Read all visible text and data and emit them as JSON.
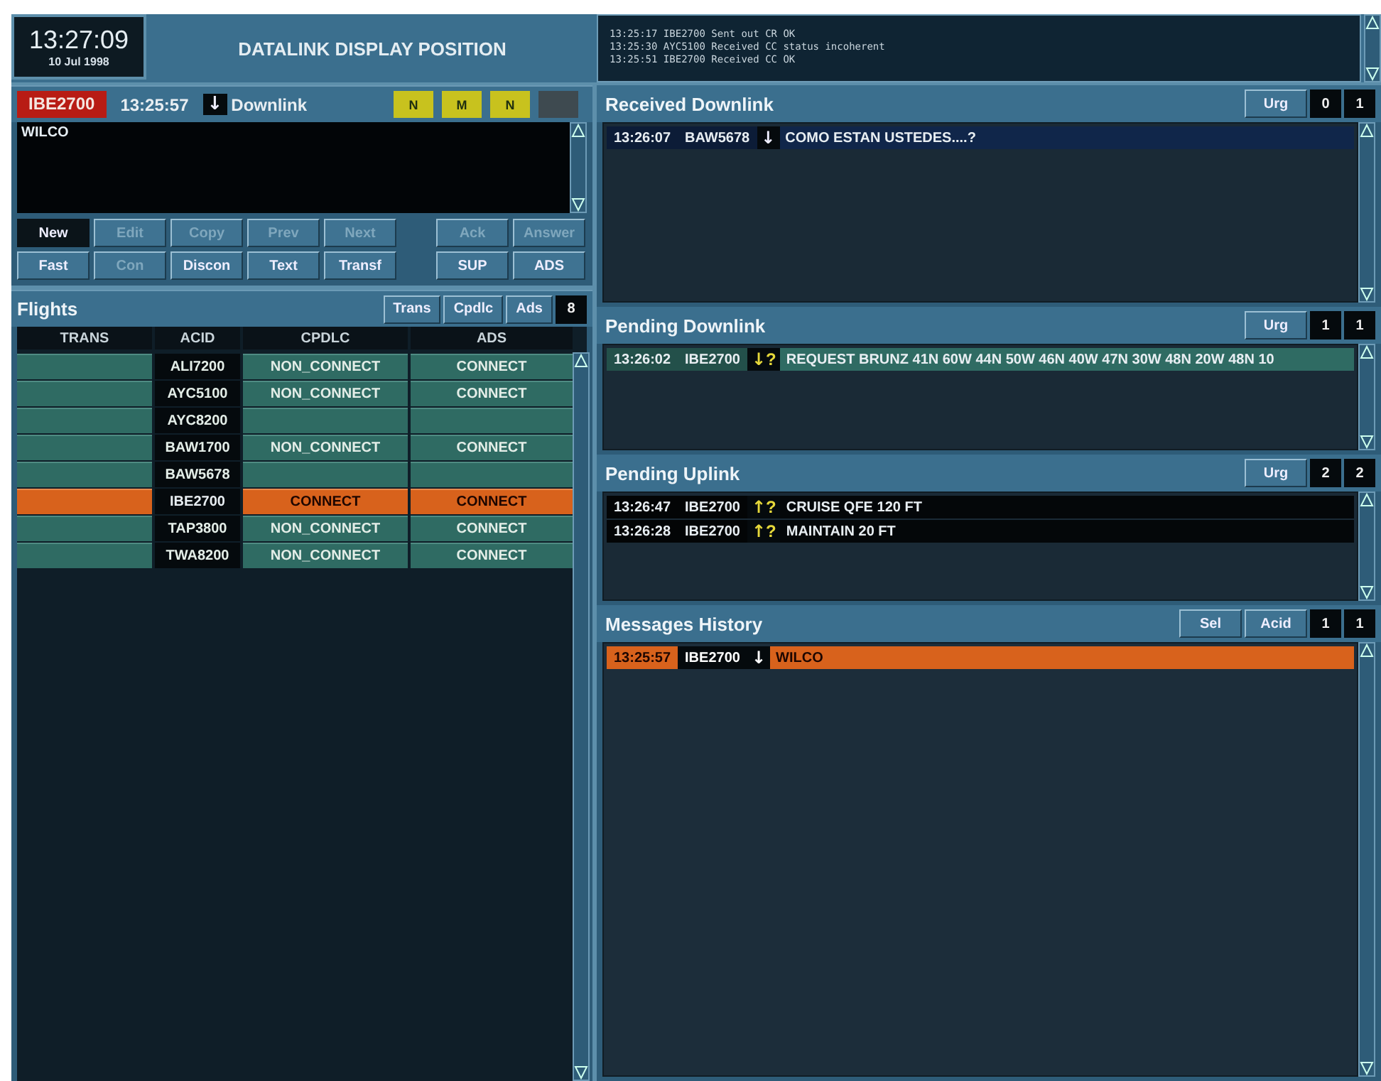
{
  "header": {
    "time": "13:27:09",
    "date": "10 Jul 1998",
    "title": "DATALINK DISPLAY POSITION",
    "log": [
      "13:25:17 IBE2700 Sent out CR OK",
      "13:25:30 AYC5100 Received CC status incoherent",
      "13:25:51 IBE2700 Received CC OK"
    ]
  },
  "message": {
    "callsign": "IBE2700",
    "time": "13:25:57",
    "arrow": "↓",
    "label": "Downlink",
    "indicators": [
      {
        "label": "N",
        "on": true
      },
      {
        "label": "M",
        "on": true
      },
      {
        "label": "N",
        "on": true
      }
    ],
    "text": "WILCO",
    "buttons": [
      [
        {
          "label": "New",
          "selected": true,
          "disabled": false
        },
        {
          "label": "Edit",
          "selected": false,
          "disabled": true
        },
        {
          "label": "Copy",
          "selected": false,
          "disabled": true
        },
        {
          "label": "Prev",
          "selected": false,
          "disabled": true
        },
        {
          "label": "Next",
          "selected": false,
          "disabled": true
        },
        {
          "label": "Ack",
          "selected": false,
          "disabled": true
        },
        {
          "label": "Answer",
          "selected": false,
          "disabled": true
        }
      ],
      [
        {
          "label": "Fast",
          "selected": false,
          "disabled": false
        },
        {
          "label": "Con",
          "selected": false,
          "disabled": true
        },
        {
          "label": "Discon",
          "selected": false,
          "disabled": false
        },
        {
          "label": "Text",
          "selected": false,
          "disabled": false
        },
        {
          "label": "Transf",
          "selected": false,
          "disabled": false
        },
        {
          "label": "SUP",
          "selected": false,
          "disabled": false
        },
        {
          "label": "ADS",
          "selected": false,
          "disabled": false
        }
      ]
    ]
  },
  "flights": {
    "title": "Flights",
    "filters": [
      "Trans",
      "Cpdlc",
      "Ads"
    ],
    "count": "8",
    "columns": [
      "TRANS",
      "ACID",
      "CPDLC",
      "ADS"
    ],
    "rows": [
      {
        "acid": "ALI7200",
        "cpdlc": "NON_CONNECT",
        "ads": "CONNECT",
        "selected": false
      },
      {
        "acid": "AYC5100",
        "cpdlc": "NON_CONNECT",
        "ads": "CONNECT",
        "selected": false
      },
      {
        "acid": "AYC8200",
        "selected": false
      },
      {
        "acid": "BAW1700",
        "cpdlc": "NON_CONNECT",
        "ads": "CONNECT",
        "selected": false
      },
      {
        "acid": "BAW5678",
        "selected": false
      },
      {
        "acid": "IBE2700",
        "cpdlc": "CONNECT",
        "ads": "CONNECT",
        "selected": true
      },
      {
        "acid": "TAP3800",
        "cpdlc": "NON_CONNECT",
        "ads": "CONNECT",
        "selected": false
      },
      {
        "acid": "TWA8200",
        "cpdlc": "NON_CONNECT",
        "ads": "CONNECT",
        "selected": false
      }
    ]
  },
  "sections": [
    {
      "kind": "received",
      "title": "Received Downlink",
      "controls": [
        "Urg"
      ],
      "counts": [
        "0",
        "1"
      ],
      "messages": [
        {
          "time": "13:26:07",
          "acid": "BAW5678",
          "arrow": "↓",
          "text": "COMO ESTAN USTEDES....?",
          "selected": false
        }
      ]
    },
    {
      "kind": "pending_down",
      "title": "Pending Downlink",
      "controls": [
        "Urg"
      ],
      "counts": [
        "1",
        "1"
      ],
      "messages": [
        {
          "time": "13:26:02",
          "acid": "IBE2700",
          "arrow": "↓",
          "flag": "?",
          "text": "REQUEST BRUNZ 41N 60W 44N 50W 46N 40W 47N 30W 48N 20W 48N 10",
          "selected": false
        }
      ]
    },
    {
      "kind": "pending_up",
      "title": "Pending Uplink",
      "controls": [
        "Urg"
      ],
      "counts": [
        "2",
        "2"
      ],
      "messages": [
        {
          "time": "13:26:47",
          "acid": "IBE2700",
          "arrow": "↑",
          "flag": "?",
          "text": "CRUISE QFE 120 FT",
          "selected": false
        },
        {
          "time": "13:26:28",
          "acid": "IBE2700",
          "arrow": "↑",
          "flag": "?",
          "text": "MAINTAIN 20 FT",
          "selected": false
        }
      ]
    },
    {
      "kind": "history",
      "title": "Messages History",
      "controls": [
        "Sel",
        "Acid"
      ],
      "counts": [
        "1",
        "1"
      ],
      "messages": [
        {
          "time": "13:25:57",
          "acid": "IBE2700",
          "arrow": "↓",
          "text": "WILCO",
          "selected": true
        }
      ]
    }
  ]
}
